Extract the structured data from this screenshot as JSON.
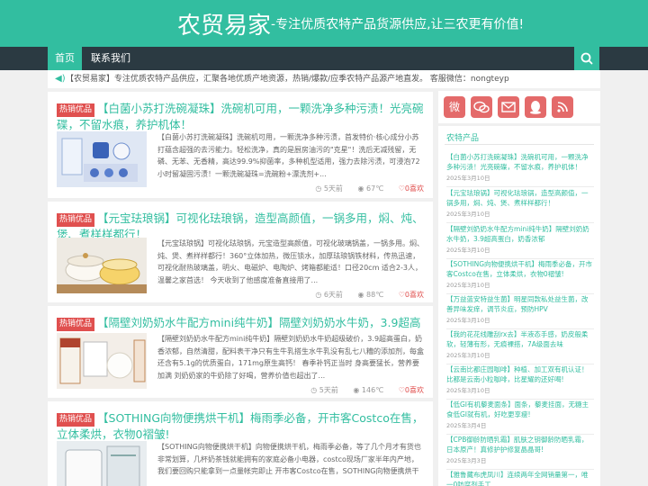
{
  "header": {
    "site_name": "农贸易家",
    "tagline": "-专注优质农特产品货源供应,让三农更有价值!"
  },
  "nav": {
    "items": [
      "首页",
      "联系我们"
    ],
    "search_icon": "search-icon"
  },
  "notice": {
    "icon": "speaker-icon",
    "text": "【农贸易家】专注优质农特产品供应，汇聚各地优质产地资源，热销/爆款/应季农特产品源产地直发。 客服微信：nongteyp"
  },
  "posts": [
    {
      "badge": "热销优品",
      "title": "【白菌小苏打洗碗凝珠】洗碗机可用，一颗洗净多种污渍！光亮碗碟，不留水痕，养护机体！",
      "excerpt": "【白菌小苏打洗碗凝珠】洗碗机可用，一颗洗净多种污渍，首发特价·核心成分小苏打蕴含超强的去污能力。轻松洗净，真的是厨房油污的\"克星\"！洗后无减残留，无磷、无苯、无香精，高达99.9%抑菌率，多种机型适用，强力去除污渍，可浸泡72小时留凝固污渍！一颗洗碗凝珠=洗碗粉+漂洗剂+...",
      "date": "5天前",
      "views": "67℃",
      "likes": "0喜欢"
    },
    {
      "badge": "热销优品",
      "title": "【元宝珐琅锅】可视化珐琅锅，造型高颜值，一锅多用，焖、炖、煲、煮样样都行！",
      "excerpt": "【元宝珐琅锅】可视化珐琅锅，元宝造型高颜值，可视化玻璃锅盖，一锅多用。焖、炖、煲、煮样样都行！360°立体加热，微压锁水，加厚珐琅锅铁材料，传热迅速，可视化耐热玻璃盖，明火、电磁炉、电陶炉、烤箱都能适！口径20cm 适合2-3人，温馨之家首选！ 今天收到了他感度准备直接用了...",
      "date": "6天前",
      "views": "88℃",
      "likes": "0喜欢"
    },
    {
      "badge": "热销优品",
      "title": "【隔壁刘奶奶水牛配方mini纯牛奶】隔壁刘奶奶水牛奶，3.9超高蛋白，奶香浓郁",
      "excerpt": "【隔壁刘奶奶水牛配方mini纯牛奶】隔壁刘奶奶水牛奶超级破价，3.9超高蛋白，奶香浓郁，自然清甜，配料表干净只有生牛乳搭生水牛乳没有乱七八糟的添加剂，每盒还含有5.1g的优质蛋白，171mg原生高钙！ 春季补钙正当时 身高要猛长，营养要加满 刘奶奶家的牛奶除了好喝，营养价值也超出了...",
      "date": "5天前",
      "views": "146℃",
      "likes": "0喜欢"
    },
    {
      "badge": "热销优品",
      "title": "【SOTHING向物便携烘干机】梅雨季必备，开市客Costco在售，立体柔烘，衣物0褶皱!",
      "excerpt": "【SOTHING向物便携烘干机】向物便携烘干机，梅雨季必备，等了几个月才有货也非常划算，几杯奶茶钱就能拥有的家庭必备小电器，costco现场厂家半年内产地，我们要回购只能拿到一点量帐完即止 开市客Costco在售，SOTHING向物便携烘干机，天同品类销售量Top，阴天梅雨衣服也速..."
    }
  ],
  "sidebar": {
    "social_icons": [
      "weibo-icon",
      "wechat-icon",
      "mail-icon",
      "qq-icon",
      "rss-icon"
    ],
    "title": "农特产品",
    "items": [
      {
        "title": "【白菌小苏打洗碗凝珠】洗碗机可用，一颗洗净多种污渍！光亮碗碟，不留水痕，养护机体！",
        "date": "2025年3月10日"
      },
      {
        "title": "【元宝珐琅锅】可视化珐琅锅，造型高颜值，一锅多用，焖、炖、煲、煮样样都行！",
        "date": "2025年3月10日"
      },
      {
        "title": "【隔壁刘奶奶水牛配方mini纯牛奶】隔壁刘奶奶水牛奶，3.9超高蛋白，奶香浓郁",
        "date": "2025年3月10日"
      },
      {
        "title": "【SOTHING向物便携烘干机】梅雨季必备，开市客Costco在售，立体柔烘，衣物0褶皱!",
        "date": "2025年3月10日"
      },
      {
        "title": "【万益蓝安特益生菌】明星同款私处益生菌，改善异味发痒，调节炎症，预防HPV",
        "date": "2025年3月10日"
      },
      {
        "title": "【我的花花线雕刮rx去】半液态手感，奶皮般柔软，轻薄有形，无痕裸搭，7A级面去味",
        "date": "2025年3月10日"
      },
      {
        "title": "【云南比都庄园咖啡】种植、加工双有机认证！比都是云南小粒咖啡，比星耀的还好喝!",
        "date": "2025年3月10日"
      },
      {
        "title": "【低GI有机藜麦面条】面条，藜麦挂面，无糖主食低GI就有机，好吃更享瘦!",
        "date": "2025年3月4日"
      },
      {
        "title": "【CPB御龄防晒乳霜】肌肤之钥御龄防晒乳霜，日本原产！真修护护修复晶晶哥!",
        "date": "2025年3月3日"
      },
      {
        "title": "【雅鲁藏布虎凤川】连续两年全网销量第一，唯一0防腐剂手工...",
        "date": ""
      }
    ]
  },
  "colors": {
    "accent": "#32bea0",
    "nav_bg": "#2b3a42",
    "badge": "#e0504f"
  }
}
